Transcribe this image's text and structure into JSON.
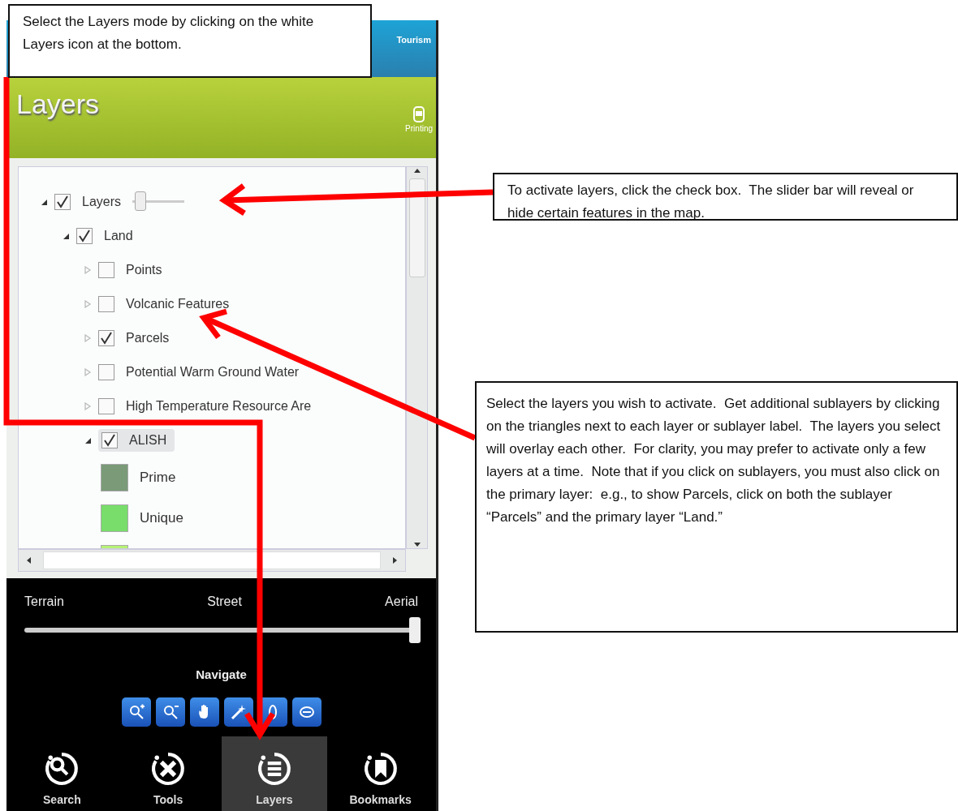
{
  "header": {
    "app_title": "Tourism",
    "title": "Layers",
    "print_label": "Printing"
  },
  "layer_tree": [
    {
      "kind": "layer",
      "label": "Layers",
      "checked": true,
      "expanded": true,
      "selected": false,
      "level": 0.05,
      "children": [
        {
          "kind": "layer",
          "label": "Land",
          "checked": true,
          "expanded": true,
          "selected": false,
          "children": [
            {
              "kind": "layer",
              "label": "Points",
              "checked": false,
              "expanded": false,
              "selected": false
            },
            {
              "kind": "layer",
              "label": "Volcanic Features",
              "checked": false,
              "expanded": false,
              "selected": false
            },
            {
              "kind": "layer",
              "label": "Parcels",
              "checked": true,
              "expanded": false,
              "selected": false
            },
            {
              "kind": "layer",
              "label": "Potential Warm Ground Water",
              "checked": false,
              "expanded": false,
              "selected": false
            },
            {
              "kind": "layer",
              "label": "High Temperature Resource Are",
              "checked": false,
              "expanded": false,
              "selected": false
            },
            {
              "kind": "layer",
              "label": "ALISH",
              "checked": true,
              "expanded": true,
              "selected": true,
              "children": [
                {
                  "kind": "legend",
                  "label": "Prime",
                  "color": "#7a9a78"
                },
                {
                  "kind": "legend",
                  "label": "Unique",
                  "color": "#78dd6a"
                },
                {
                  "kind": "legend",
                  "color": "#b6f274"
                }
              ]
            }
          ]
        }
      ]
    }
  ],
  "basemap": {
    "labels": [
      "Terrain",
      "Street",
      "Aerial"
    ],
    "level": 1
  },
  "navigate": {
    "title": "Navigate"
  },
  "tabs": [
    {
      "label": "Search",
      "selected": false
    },
    {
      "label": "Tools",
      "selected": false
    },
    {
      "label": "Layers",
      "selected": true
    },
    {
      "label": "Bookmarks",
      "selected": false
    }
  ],
  "annotations": [
    {
      "text": "Select the Layers mode by clicking on the white Layers icon at the bottom."
    },
    {
      "text": "To activate layers, click the check box.  The slider bar will reveal or hide certain features in the map."
    },
    {
      "text": "Select the layers you wish to activate.  Get additional sublayers by clicking on the triangles next to each layer or sublayer label.  The layers you select will overlay each other.  For clarity, you may prefer to activate only a few layers at a time.  Note that if you click on sublayers, you must also click on the primary layer:  e.g., to show Parcels, click on both the sublayer “Parcels” and the primary layer “Land.”"
    }
  ]
}
